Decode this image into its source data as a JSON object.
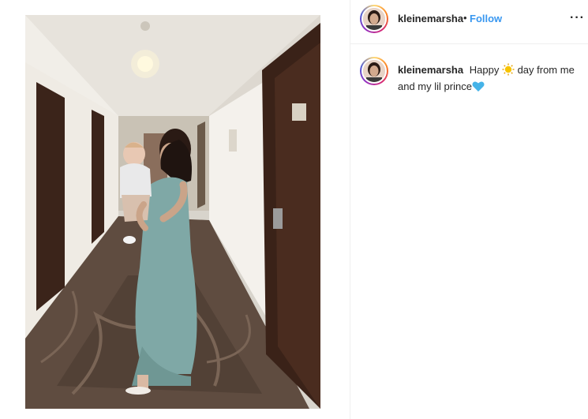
{
  "post": {
    "username": "kleinemarsha",
    "separator": "•",
    "follow_label": "Follow",
    "more_label": "···",
    "caption": {
      "username": "kleinemarsha",
      "text_before": "Happy",
      "text_middle": "day from me and my lil prince",
      "emoji_1": "sun-icon",
      "emoji_2": "blue-heart-icon"
    }
  },
  "colors": {
    "follow_blue": "#3897f0",
    "text": "#262626",
    "divider": "#efefef",
    "dress": "#7fa8a6",
    "door": "#3b241a"
  }
}
